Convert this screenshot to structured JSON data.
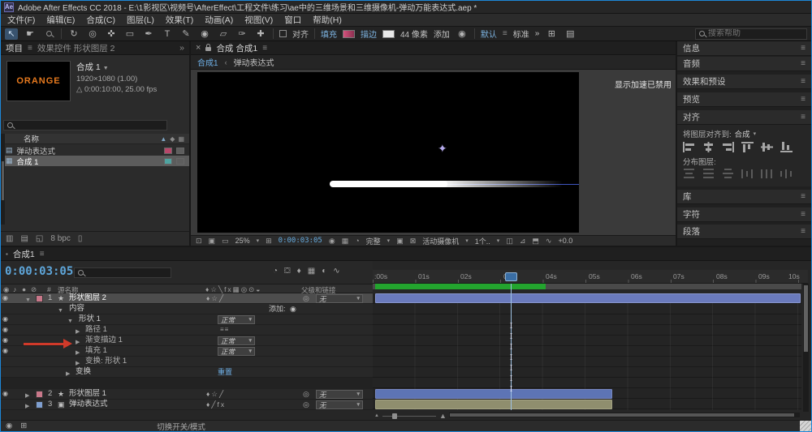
{
  "window": {
    "app_badge": "Ae",
    "title": "Adobe After Effects CC 2018 - E:\\1影视区\\视频号\\AfterEffect\\工程文件\\练习\\ae中的三维场景和三维摄像机-弹动万能表达式.aep *"
  },
  "menu": {
    "items": [
      "文件(F)",
      "编辑(E)",
      "合成(C)",
      "图层(L)",
      "效果(T)",
      "动画(A)",
      "视图(V)",
      "窗口",
      "帮助(H)"
    ]
  },
  "toolbar": {
    "snap_label": "对齐",
    "fill_label": "填充",
    "stroke_label": "描边",
    "stroke_width": "44 像素",
    "add_label": "添加",
    "workspace_active": "默认",
    "workspace_next": "标准",
    "more": "»",
    "search_placeholder": "搜索帮助"
  },
  "project": {
    "tab_project": "项目",
    "tab_effect_controls": "效果控件 形状图层 2",
    "overflow": "»",
    "thumb_text": "ORANGE",
    "comp_name": "合成 1",
    "comp_size": "1920×1080 (1.00)",
    "comp_time": "△ 0:00:10:00, 25.00 fps",
    "col_name": "名称",
    "rows": [
      {
        "name": "弹动表达式"
      },
      {
        "name": "合成 1"
      }
    ],
    "bpc": "8 bpc"
  },
  "viewer": {
    "tab_label": "合成 合成1",
    "crumb_comp": "合成1",
    "crumb_layer": "弹动表达式",
    "overlay": "显示加速已禁用",
    "zoom": "25%",
    "timecode": "0:00:03:05",
    "resolution": "完整",
    "camera_view": "活动摄像机",
    "view_layout": "1个..",
    "exposure": "+0.0"
  },
  "side": {
    "info": "信息",
    "audio": "音频",
    "effects_presets": "效果和预设",
    "preview": "预览",
    "align": "对齐",
    "align_to": "将图层对齐到:",
    "align_target": "合成",
    "distribute": "分布图层:",
    "library": "库",
    "character": "字符",
    "paragraph": "段落"
  },
  "timeline": {
    "tab": "合成1",
    "timecode": "0:00:03:05",
    "col_number": "#",
    "col_source_name": "源名称",
    "col_parent": "父级和链接",
    "add_label": "添加:",
    "reset_label": "重置",
    "footer_hint": "切换开关/模式",
    "ruler": [
      ":00s",
      "01s",
      "02s",
      "03s",
      "04s",
      "05s",
      "06s",
      "07s",
      "08s",
      "09s",
      "10s"
    ],
    "rows": [
      {
        "num": "1",
        "name": "形状图层 2",
        "parent": "无"
      },
      {
        "name": "内容"
      },
      {
        "name": "形状 1",
        "mode": "正常"
      },
      {
        "name": "路径 1"
      },
      {
        "name": "渐变描边 1",
        "mode": "正常"
      },
      {
        "name": "填充 1",
        "mode": "正常"
      },
      {
        "name": "变换: 形状 1"
      },
      {
        "name": "变换"
      },
      {
        "num": "2",
        "name": "形状图层 1",
        "parent": "无"
      },
      {
        "num": "3",
        "name": "弹动表达式",
        "parent": "无"
      }
    ]
  },
  "colors": {
    "accent_blue": "#5ea6da",
    "bar_blue": "#6a7abc",
    "bar_olive": "#8f8e6e",
    "cached_green": "#23a42e",
    "annotation_red": "#d03a2a",
    "thumb_orange": "#e87a1e"
  }
}
